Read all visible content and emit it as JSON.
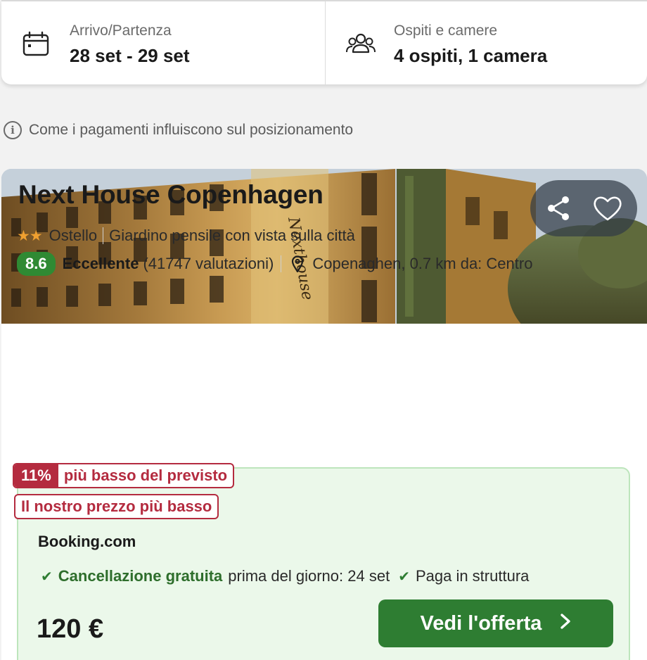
{
  "search": {
    "dates_label": "Arrivo/Partenza",
    "dates_value": "28 set - 29 set",
    "guests_label": "Ospiti e camere",
    "guests_value": "4 ospiti, 1 camera"
  },
  "info": {
    "text": "Come i pagamenti influiscono sul posizionamento"
  },
  "hotel": {
    "name": "Next House Copenhagen",
    "stars_glyph": "★★",
    "type": "Ostello",
    "feature": "Giardino pensile con vista sulla città",
    "rating": "8.6",
    "rating_word": "Eccellente",
    "reviews": "(41747 valutazioni)",
    "location": "Copenaghen, 0.7 km da: Centro",
    "photo_sign": "Nexthouse"
  },
  "deal": {
    "discount_pct": "11%",
    "discount_text": "più basso del previsto",
    "best_price_text": "Il nostro prezzo più basso",
    "provider": "Booking.com",
    "check_glyph": "✔",
    "cancellation_bold": "Cancellazione gratuita",
    "cancellation_rest": "prima del giorno: 24 set",
    "pay_text": "Paga in struttura",
    "price": "120 €",
    "cta_label": "Vedi l'offerta"
  },
  "icons": {
    "calendar": "calendar-icon",
    "guests": "guests-icon",
    "info": "info-icon",
    "share": "share-icon",
    "heart": "heart-icon",
    "pin": "map-pin-icon",
    "chevron": "chevron-right-icon"
  },
  "colors": {
    "rating_green": "#2f8a33",
    "cta_green": "#2e7d32",
    "deal_red": "#b42b3f",
    "deal_bg": "#ebf8ea",
    "star_orange": "#f0a030"
  }
}
